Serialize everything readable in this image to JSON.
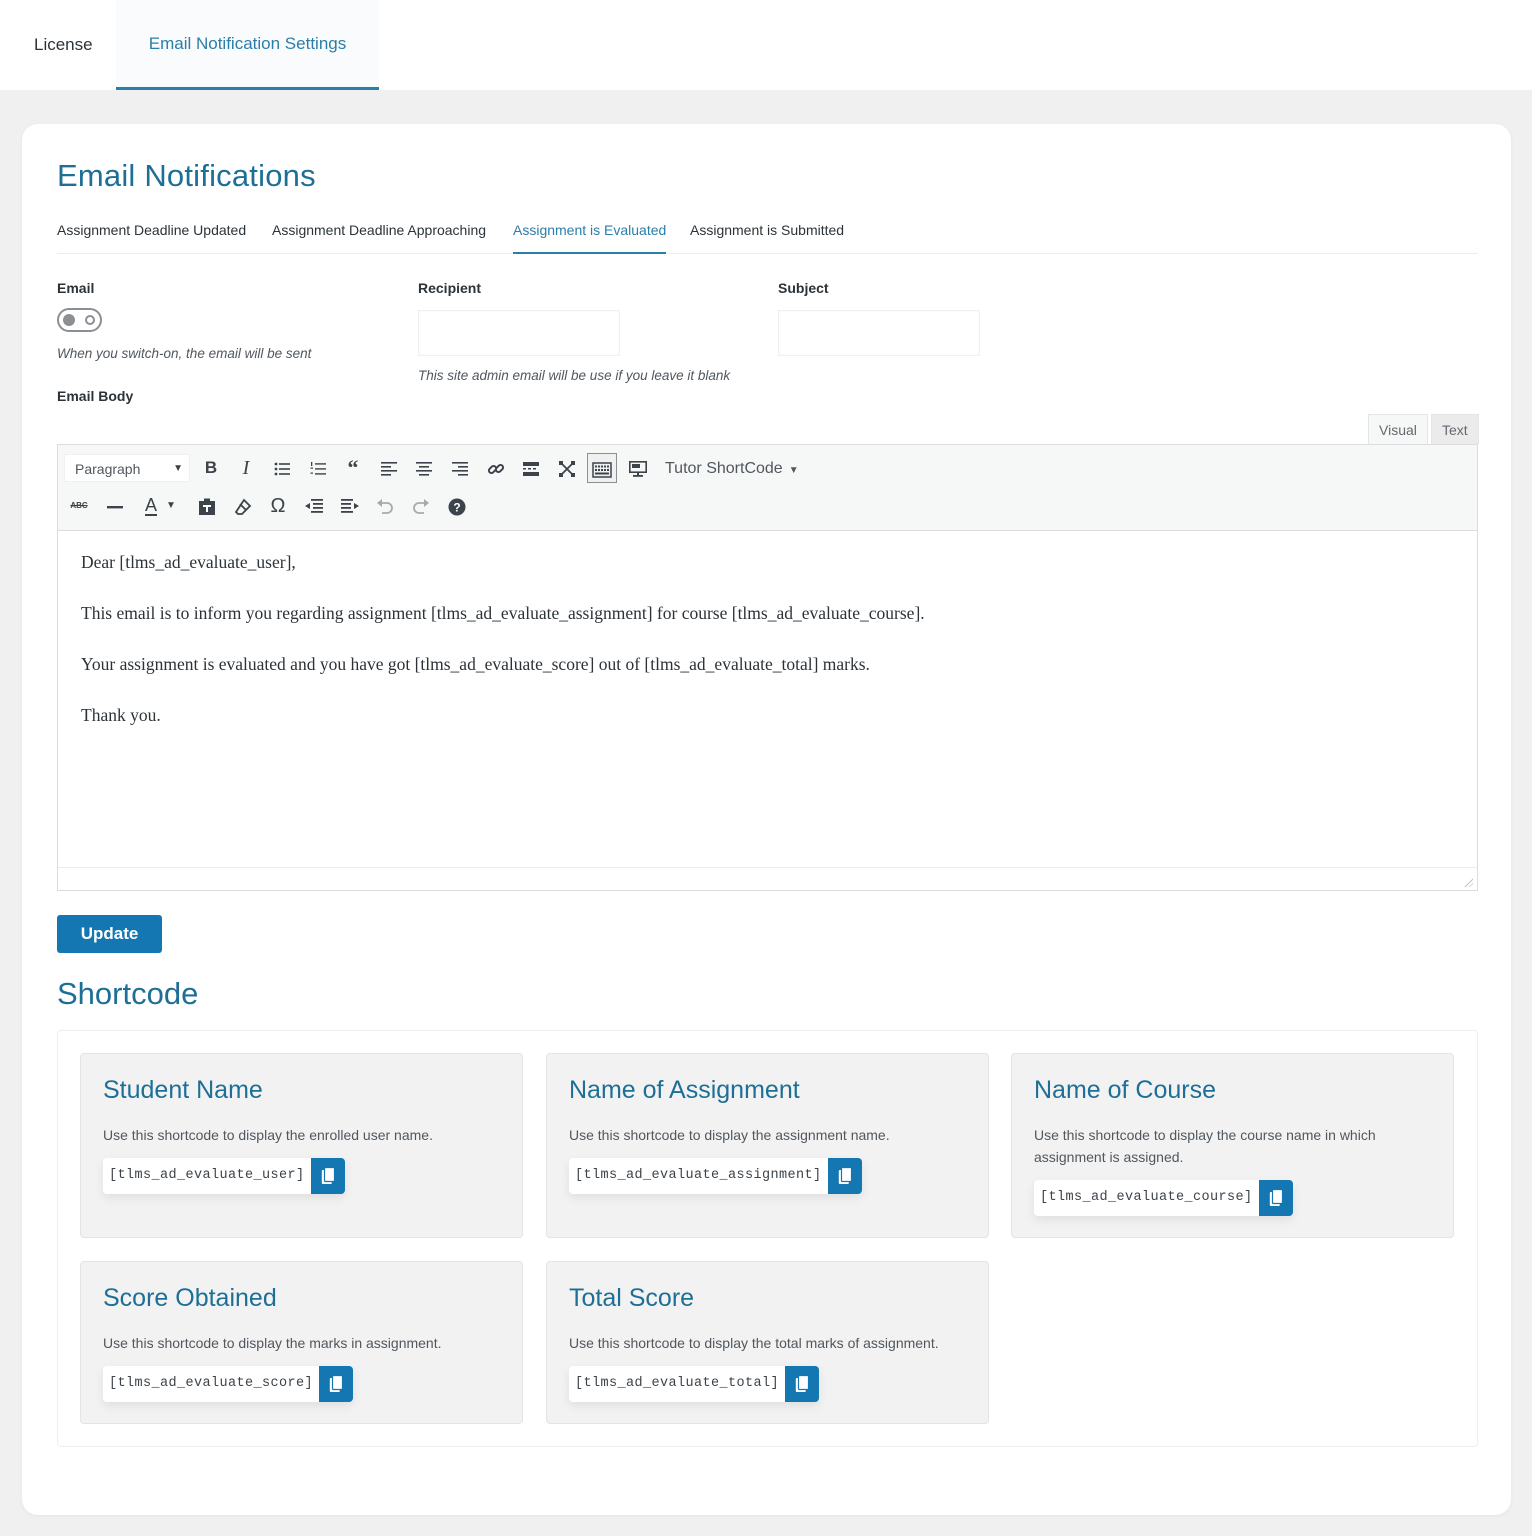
{
  "top_tabs": [
    {
      "label": "License",
      "active": false
    },
    {
      "label": "Email Notification Settings",
      "active": true
    }
  ],
  "page_title": "Email Notifications",
  "sub_tabs": [
    {
      "label": "Assignment Deadline Updated",
      "active": false
    },
    {
      "label": "Assignment Deadline Approaching",
      "active": false
    },
    {
      "label": "Assignment is Evaluated",
      "active": true
    },
    {
      "label": "Assignment is Submitted",
      "active": false
    }
  ],
  "form": {
    "email_label": "Email",
    "email_toggle_on": false,
    "email_hint": "When you switch-on, the email will be sent",
    "recipient_label": "Recipient",
    "recipient_value": "",
    "recipient_hint": "This site admin email will be use if you leave it blank",
    "subject_label": "Subject",
    "subject_value": "",
    "body_label": "Email Body"
  },
  "editor": {
    "mode_tabs": {
      "visual": "Visual",
      "text": "Text"
    },
    "format_select": "Paragraph",
    "shortcode_menu": "Tutor ShortCode",
    "toolbar_row1": [
      "bold-icon",
      "italic-icon",
      "bullet-list-icon",
      "numbered-list-icon",
      "blockquote-icon",
      "align-left-icon",
      "align-center-icon",
      "align-right-icon",
      "link-icon",
      "read-more-icon",
      "fullscreen-icon",
      "toolbar-toggle-icon",
      "preview-icon"
    ],
    "toolbar_row2": [
      "strikethrough-icon",
      "horizontal-line-icon",
      "text-color-icon",
      "paste-text-icon",
      "clear-formatting-icon",
      "special-character-icon",
      "outdent-icon",
      "indent-icon",
      "undo-icon",
      "redo-icon",
      "help-icon"
    ],
    "body_paragraphs": [
      "Dear [tlms_ad_evaluate_user],",
      "This email is to inform you regarding assignment [tlms_ad_evaluate_assignment] for course [tlms_ad_evaluate_course].",
      "Your assignment is evaluated and you have got [tlms_ad_evaluate_score] out of [tlms_ad_evaluate_total] marks.",
      "Thank you."
    ]
  },
  "update_button": "Update",
  "shortcode_section": {
    "title": "Shortcode",
    "cards": [
      {
        "title": "Student Name",
        "description": "Use this shortcode to display the enrolled user name.",
        "code": "[tlms_ad_evaluate_user]"
      },
      {
        "title": "Name of Assignment",
        "description": "Use this shortcode to display the assignment name.",
        "code": "[tlms_ad_evaluate_assignment]"
      },
      {
        "title": "Name of Course",
        "description": "Use this shortcode to display the course name in which assignment is assigned.",
        "code": "[tlms_ad_evaluate_course]"
      },
      {
        "title": "Score Obtained",
        "description": "Use this shortcode to display the marks in assignment.",
        "code": "[tlms_ad_evaluate_score]"
      },
      {
        "title": "Total Score",
        "description": "Use this shortcode to display the total marks of assignment.",
        "code": "[tlms_ad_evaluate_total]"
      }
    ]
  },
  "colors": {
    "accent": "#1e6f96",
    "tab_active": "#2a7ea8",
    "button": "#1477b2",
    "page_bg": "#f0f0f1"
  }
}
